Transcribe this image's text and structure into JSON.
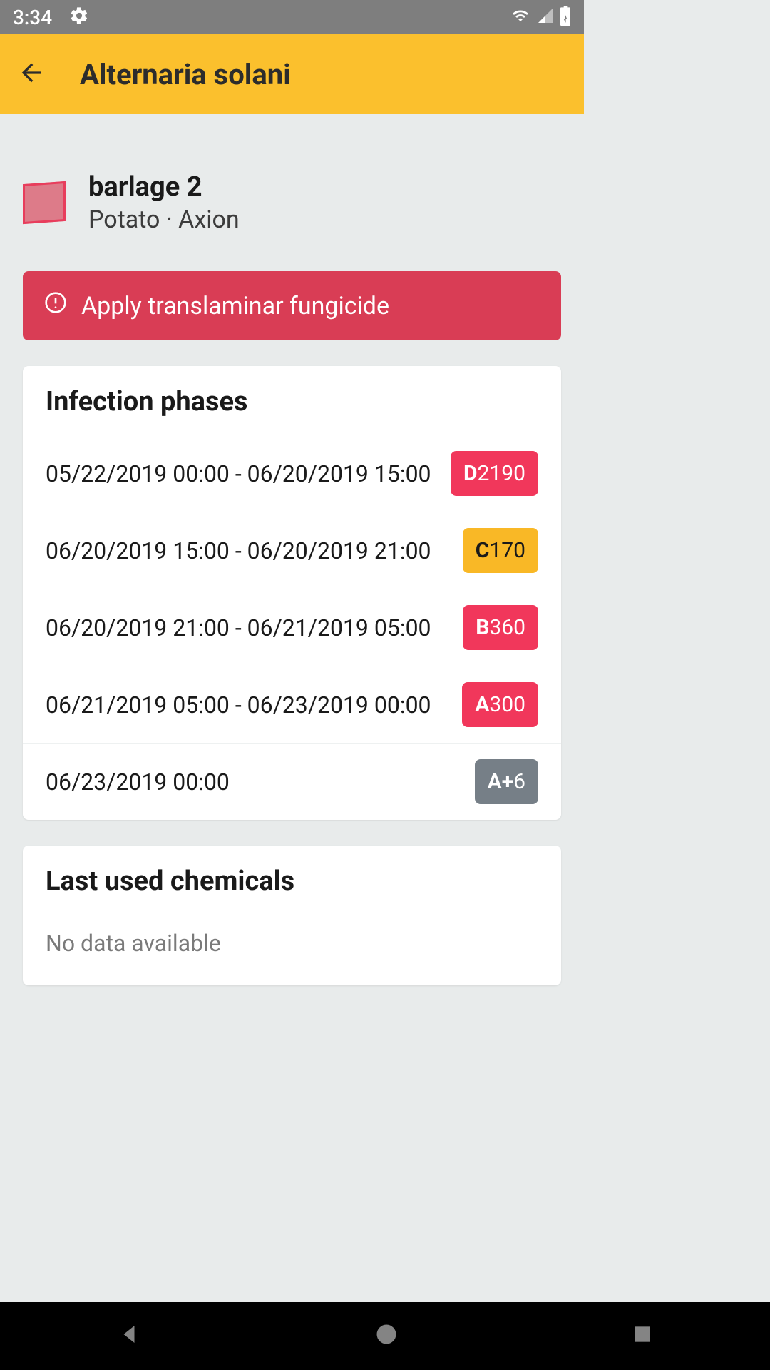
{
  "status": {
    "time": "3:34"
  },
  "app": {
    "title": "Alternaria solani"
  },
  "field": {
    "name": "barlage 2",
    "crop": "Potato · Axion"
  },
  "alert": {
    "text": "Apply translaminar fungicide"
  },
  "phases": {
    "header": "Infection phases",
    "rows": [
      {
        "date": "05/22/2019 00:00 - 06/20/2019 15:00",
        "letter": "D",
        "value": "2190",
        "color": "red"
      },
      {
        "date": "06/20/2019 15:00 - 06/20/2019 21:00",
        "letter": "C",
        "value": "170",
        "color": "yellow"
      },
      {
        "date": "06/20/2019 21:00 - 06/21/2019 05:00",
        "letter": "B",
        "value": "360",
        "color": "red"
      },
      {
        "date": "06/21/2019 05:00 - 06/23/2019 00:00",
        "letter": "A",
        "value": "300",
        "color": "red"
      },
      {
        "date": "06/23/2019 00:00",
        "letter": "A+",
        "value": "6",
        "color": "gray"
      }
    ]
  },
  "chemicals": {
    "header": "Last used chemicals",
    "empty": "No data available"
  }
}
